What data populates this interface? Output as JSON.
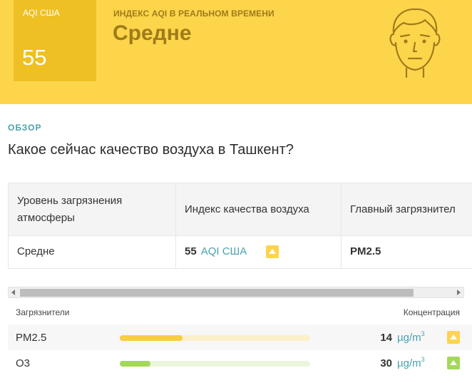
{
  "hero": {
    "aqi_label": "AQI США",
    "aqi_value": "55",
    "subtitle": "ИНДЕКС AQI В РЕАЛЬНОМ ВРЕМЕНИ",
    "status": "Средне",
    "face_icon": "moderate-face-icon",
    "bg_color": "#fdd54b",
    "box_color": "#eec024",
    "text_color": "#9f7b1a"
  },
  "overview": {
    "label": "ОБЗОР",
    "question": "Какое сейчас качество воздуха в Ташкент?"
  },
  "summary_table": {
    "headers": [
      "Уровень загрязнения атмосферы",
      "Индекс качества воздуха",
      "Главный загрязнител"
    ],
    "row": {
      "level": "Средне",
      "aqi_value": "55",
      "aqi_unit": "AQI США",
      "main_pollutant": "PM2.5"
    }
  },
  "pollutants": {
    "header_left": "Загрязнители",
    "header_right": "Концентрация",
    "items": [
      {
        "name": "PM2.5",
        "value": "14",
        "unit": "µg/m",
        "unit_sup": "3",
        "level": 0.33,
        "bar_color": "#f7ce42",
        "track_color": "#fbf0c9",
        "badge_color": "#fdd54b"
      },
      {
        "name": "O3",
        "value": "30",
        "unit": "µg/m",
        "unit_sup": "3",
        "level": 0.16,
        "bar_color": "#a4d85a",
        "track_color": "#ebf5dc",
        "badge_color": "#a4d85a"
      }
    ]
  }
}
